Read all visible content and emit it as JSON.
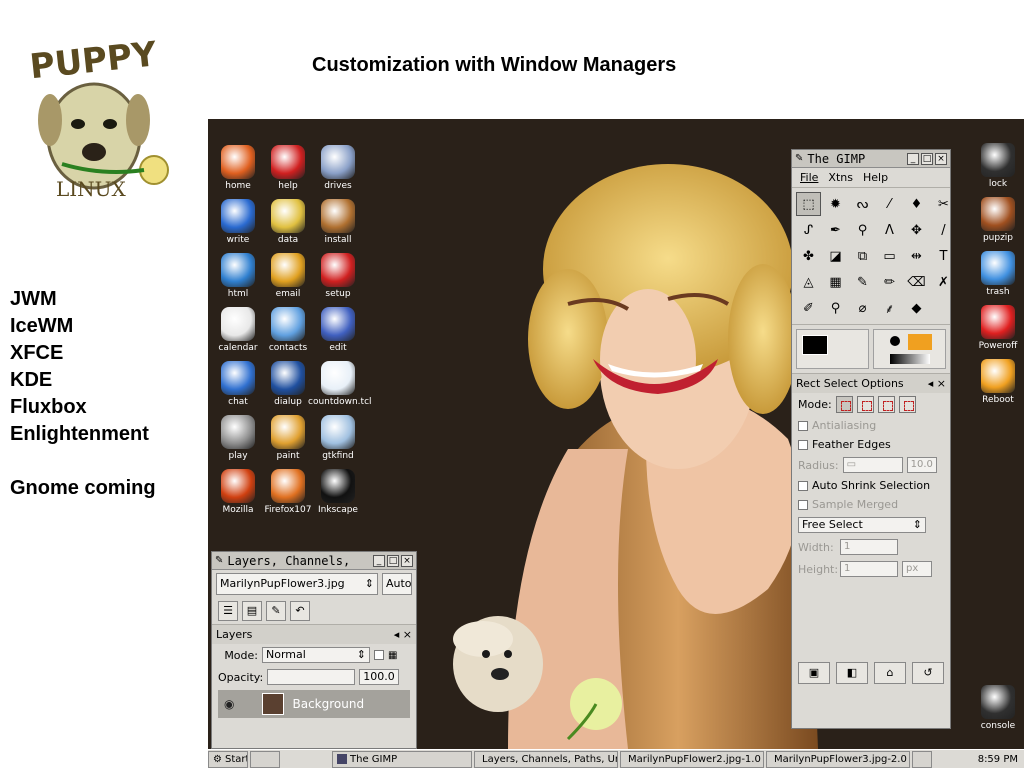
{
  "slide": {
    "title": "Customization with Window Managers",
    "window_managers": [
      "JWM",
      "IceWM",
      "XFCE",
      "KDE",
      "Fluxbox",
      "Enlightenment"
    ],
    "coming": "Gnome coming",
    "logo_text_top": "PUPPY",
    "logo_text_bottom": "LINUX"
  },
  "desktop_icons": [
    {
      "label": "home",
      "icon": "home-icon",
      "color": "#e06020"
    },
    {
      "label": "help",
      "icon": "help-icon",
      "color": "#d02020"
    },
    {
      "label": "drives",
      "icon": "drives-icon",
      "color": "#8aa0c8"
    },
    {
      "label": "write",
      "icon": "write-icon",
      "color": "#2a6ad0"
    },
    {
      "label": "data",
      "icon": "data-icon",
      "color": "#e0c040"
    },
    {
      "label": "install",
      "icon": "install-icon",
      "color": "#b07030"
    },
    {
      "label": "html",
      "icon": "html-icon",
      "color": "#3080d0"
    },
    {
      "label": "email",
      "icon": "email-icon",
      "color": "#e0a020"
    },
    {
      "label": "setup",
      "icon": "setup-icon",
      "color": "#d02020"
    },
    {
      "label": "calendar",
      "icon": "calendar-icon",
      "color": "#e8e8e8"
    },
    {
      "label": "contacts",
      "icon": "contacts-icon",
      "color": "#60a0e0"
    },
    {
      "label": "edit",
      "icon": "edit-icon",
      "color": "#4060c0"
    },
    {
      "label": "chat",
      "icon": "chat-icon",
      "color": "#3070d0"
    },
    {
      "label": "dialup",
      "icon": "dialup-icon",
      "color": "#2050a0"
    },
    {
      "label": "countdown.tcl",
      "icon": "clock-icon",
      "color": "#e8f0f8"
    },
    {
      "label": "play",
      "icon": "play-icon",
      "color": "#909090"
    },
    {
      "label": "paint",
      "icon": "paint-icon",
      "color": "#e0a030"
    },
    {
      "label": "gtkfind",
      "icon": "search-icon",
      "color": "#a0c0e0"
    },
    {
      "label": "Mozilla",
      "icon": "mozilla-icon",
      "color": "#d04010"
    },
    {
      "label": "Firefox107",
      "icon": "firefox-icon",
      "color": "#e07020"
    },
    {
      "label": "Inkscape",
      "icon": "inkscape-icon",
      "color": "#111111"
    }
  ],
  "right_icons": [
    {
      "label": "lock",
      "icon": "monitor-icon",
      "color": "#303030"
    },
    {
      "label": "pupzip",
      "icon": "archive-icon",
      "color": "#a05020"
    },
    {
      "label": "trash",
      "icon": "trash-icon",
      "color": "#4090e0"
    },
    {
      "label": "Poweroff",
      "icon": "close-icon",
      "color": "#e02020"
    },
    {
      "label": "Reboot",
      "icon": "reboot-icon",
      "color": "#f0a020"
    },
    {
      "label": "console",
      "icon": "console-icon",
      "color": "#303030"
    }
  ],
  "gimp": {
    "title": "The GIMP",
    "menu": [
      "File",
      "Xtns",
      "Help"
    ],
    "tools": [
      "⬚",
      "✹",
      "ᔓ",
      "⁄",
      "♦",
      "✂",
      "ᔑ",
      "✒",
      "⚲",
      "Λ",
      "✥",
      "/",
      "✤",
      "◪",
      "⧉",
      "▭",
      "⇹",
      "T",
      "◬",
      "▦",
      "✎",
      "✏",
      "⌫",
      "✗",
      "✐",
      "⚲",
      "⌀",
      "⸙",
      "◆"
    ],
    "options_title": "Rect Select Options",
    "mode_label": "Mode:",
    "antialiasing": "Antialiasing",
    "feather_edges": "Feather Edges",
    "radius_label": "Radius:",
    "radius_value": "10.0",
    "auto_shrink": "Auto Shrink Selection",
    "sample_merged": "Sample Merged",
    "select_mode": "Free Select",
    "width_label": "Width:",
    "width_value": "1",
    "height_label": "Height:",
    "height_value": "1",
    "unit": "px"
  },
  "layers": {
    "title": "Layers, Channels,",
    "image_select": "MarilynPupFlower3.jpg",
    "auto_label": "Auto",
    "section_title": "Layers",
    "mode_label": "Mode:",
    "mode_value": "Normal",
    "opacity_label": "Opacity:",
    "opacity_value": "100.0",
    "layer_name": "Background"
  },
  "taskbar": {
    "start": "Start",
    "tasks": [
      "The GIMP",
      "Layers, Channels, Paths, Ur",
      "MarilynPupFlower2.jpg-1.0 (",
      "MarilynPupFlower3.jpg-2.0 ("
    ],
    "time": "8:59 PM"
  }
}
